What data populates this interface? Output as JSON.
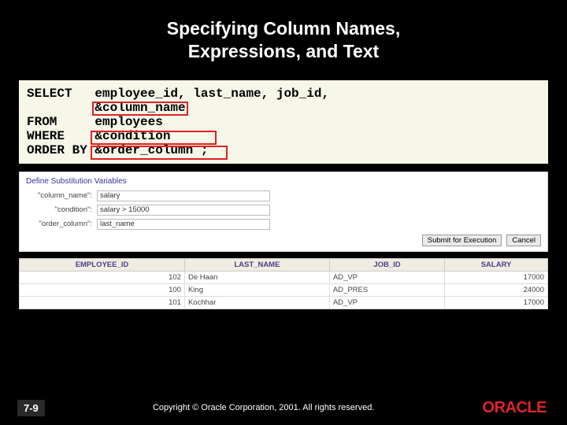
{
  "title_line1": "Specifying Column Names,",
  "title_line2": "Expressions, and Text",
  "sql": {
    "l1": "SELECT   employee_id, last_name, job_id,",
    "l2": "         &column_name",
    "l3": "FROM     employees",
    "l4": "WHERE    &condition",
    "l5": "ORDER BY &order_column ;"
  },
  "subvars": {
    "heading": "Define Substitution Variables",
    "rows": [
      {
        "label": "\"column_name\":",
        "value": "salary"
      },
      {
        "label": "\"condition\":",
        "value": "salary > 15000"
      },
      {
        "label": "\"order_column\":",
        "value": "last_name"
      }
    ],
    "submit": "Submit for Execution",
    "cancel": "Cancel"
  },
  "results": {
    "headers": [
      "EMPLOYEE_ID",
      "LAST_NAME",
      "JOB_ID",
      "SALARY"
    ],
    "rows": [
      {
        "id": "102",
        "ln": "De Haan",
        "job": "AD_VP",
        "sal": "17000"
      },
      {
        "id": "100",
        "ln": "King",
        "job": "AD_PRES",
        "sal": "24000"
      },
      {
        "id": "101",
        "ln": "Kochhar",
        "job": "AD_VP",
        "sal": "17000"
      }
    ]
  },
  "footer": {
    "slide_no": "7-9",
    "copyright": "Copyright © Oracle Corporation, 2001. All rights reserved.",
    "brand": "ORACLE"
  }
}
